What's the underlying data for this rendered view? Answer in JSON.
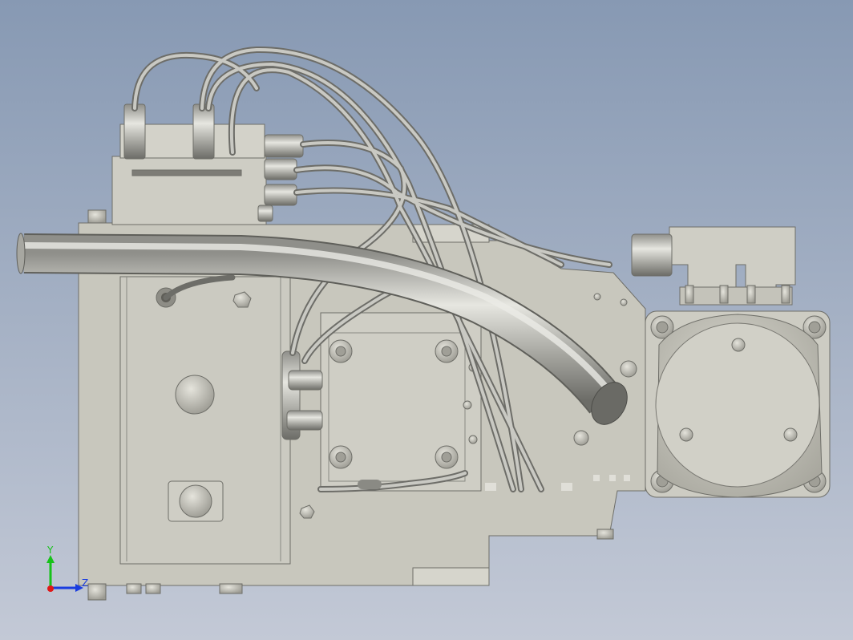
{
  "viewport": {
    "background_top": "#8799b3",
    "background_bottom": "#c3c9d6",
    "part_color": "#c8c7bd",
    "part_edge": "#6e6e68",
    "hose_color": "#a9a9a3"
  },
  "triad": {
    "y_label": "Y",
    "z_label": "Z",
    "y_color": "#17c21a",
    "z_color": "#1a3de0",
    "x_color": "#e01818"
  }
}
